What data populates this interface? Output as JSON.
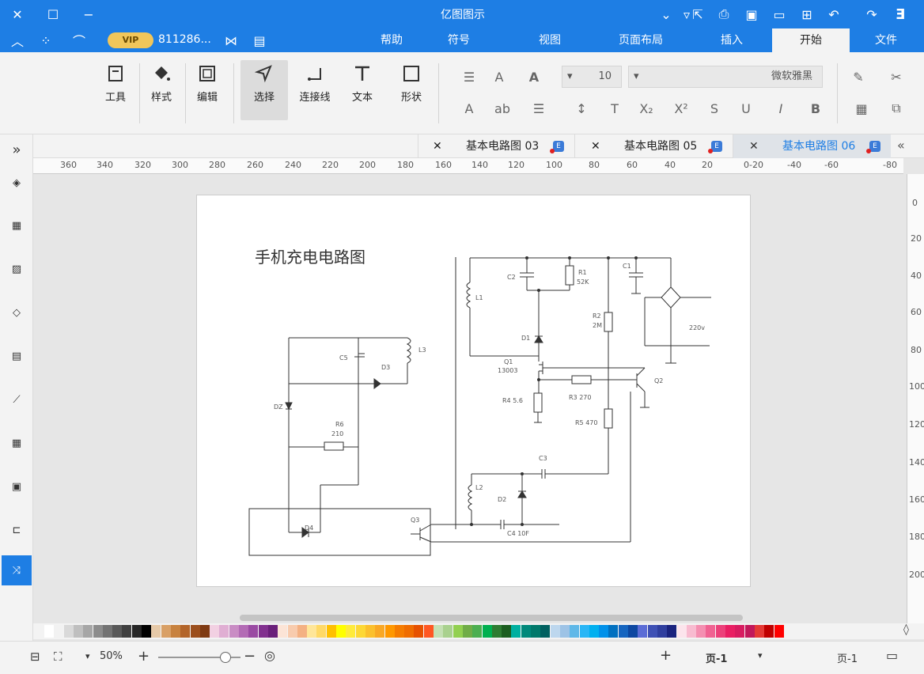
{
  "app": {
    "title": "亿图图示"
  },
  "account": {
    "id": "811286...",
    "vip": "VIP"
  },
  "menu": {
    "items": [
      "文件",
      "开始",
      "插入",
      "页面布局",
      "视图",
      "符号",
      "帮助"
    ],
    "active": "开始"
  },
  "ribbon": {
    "font_name": "微软雅黑",
    "font_size": "10",
    "tools": {
      "select": "选择",
      "connector": "连接线",
      "text": "文本",
      "shape": "形状",
      "tools": "工具",
      "style": "样式",
      "edit": "编辑"
    }
  },
  "tabs": [
    {
      "label": "基本电路图 06",
      "active": true
    },
    {
      "label": "基本电路图 05",
      "active": false
    },
    {
      "label": "基本电路图 03",
      "active": false
    }
  ],
  "ruler": {
    "h_labels": [
      "-80",
      "-60",
      "-40",
      "-20",
      "0",
      "20",
      "40",
      "60",
      "80",
      "100",
      "120",
      "140",
      "160",
      "180",
      "200",
      "220",
      "240",
      "260",
      "280",
      "300",
      "320",
      "340",
      "360"
    ],
    "v_labels": [
      "0",
      "20",
      "40",
      "60",
      "80",
      "100",
      "120",
      "140",
      "160",
      "180",
      "200"
    ]
  },
  "diagram": {
    "title": "手机充电电路图",
    "labels": {
      "c1": "C1",
      "c2": "C2",
      "r1": "R1",
      "r1v": "52K",
      "l1": "L1",
      "d1": "D1",
      "q1": "Q1",
      "q1v": "13003",
      "r2": "R2",
      "r2v": "2M",
      "r3": "R3 270",
      "r4": "R4 5.6",
      "r5": "R5 470",
      "q2": "Q2",
      "ac": "220v",
      "c3": "C3",
      "l2": "L2",
      "d2": "D2",
      "c4": "C4 10F",
      "q3": "Q3",
      "l3": "L3",
      "c5": "C5",
      "d3": "D3",
      "dz": "DZ",
      "r6": "R6",
      "r6v": "210",
      "d4": "D4"
    }
  },
  "status": {
    "page_name": "页-1",
    "page_tab": "页-1",
    "zoom": "50%"
  },
  "colors": {
    "accent": "#1e7ee4",
    "palette": [
      "#ffffff",
      "#f2f2f2",
      "#d9d9d9",
      "#bfbfbf",
      "#a6a6a6",
      "#8c8c8c",
      "#737373",
      "#595959",
      "#404040",
      "#262626",
      "#000000",
      "#e6c9a8",
      "#d9a066",
      "#c8823f",
      "#b3652a",
      "#9c4f1d",
      "#7f3a12",
      "#f2d0e2",
      "#e0aed3",
      "#c98cc4",
      "#b36bb5",
      "#9a4aa3",
      "#82308f",
      "#6a1f7a",
      "#fce4d6",
      "#f8cbad",
      "#f4b183",
      "#ffe699",
      "#ffd966",
      "#ffc000",
      "#ffff00",
      "#ffeb3b",
      "#fdd835",
      "#fbc02d",
      "#f9a825",
      "#ff9800",
      "#f57c00",
      "#ef6c00",
      "#e65100",
      "#ff5722",
      "#c5e0b4",
      "#a9d18e",
      "#92d050",
      "#70ad47",
      "#4caf50",
      "#00b050",
      "#2e7d32",
      "#1b5e20",
      "#00b0a0",
      "#00897b",
      "#00796b",
      "#006060",
      "#bdd7ee",
      "#9dc3e6",
      "#5fb8e8",
      "#29b6f6",
      "#00b0f0",
      "#0091ea",
      "#0070c0",
      "#1565c0",
      "#0d47a1",
      "#5b6cd6",
      "#3f51b5",
      "#303f9f",
      "#1a237e",
      "#fce4ec",
      "#f8bbd0",
      "#f48fb1",
      "#f06292",
      "#ec407a",
      "#e91e63",
      "#d81b60",
      "#c2185b",
      "#e53935",
      "#c00000",
      "#ff0000"
    ]
  }
}
